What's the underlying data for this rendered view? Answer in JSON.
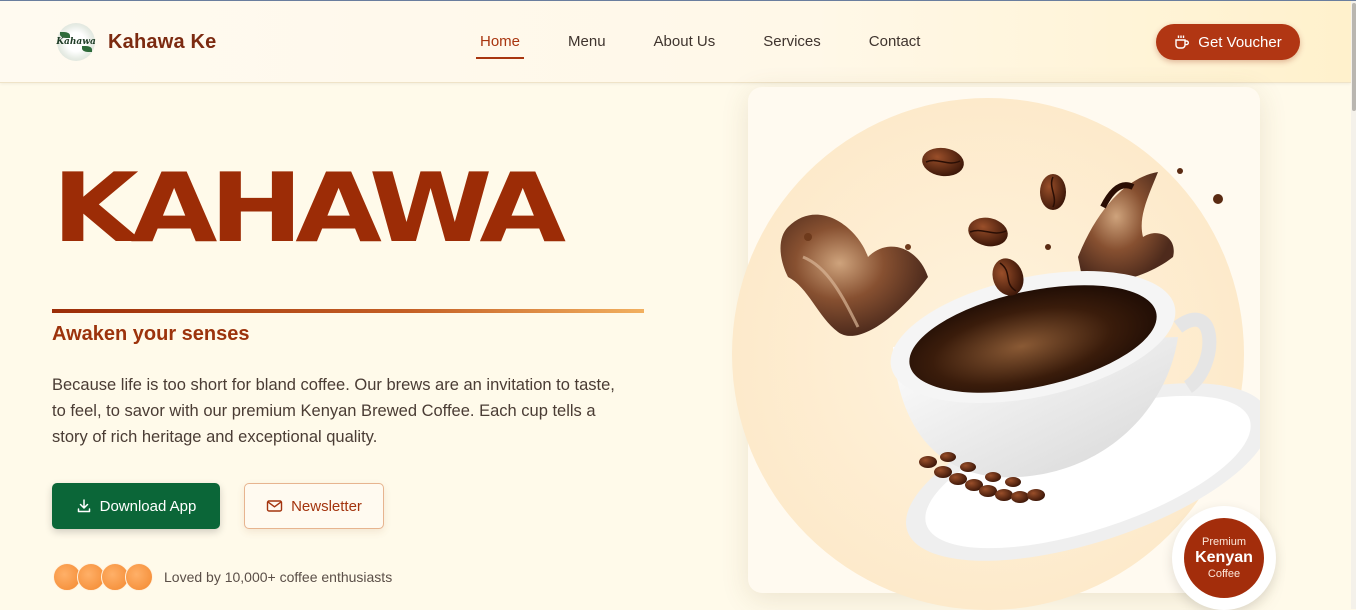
{
  "nav": {
    "brand": "Kahawa Ke",
    "logo_text": "Kahawa",
    "links": [
      "Home",
      "Menu",
      "About Us",
      "Services",
      "Contact"
    ],
    "active": "Home",
    "cta_label": "Get Voucher",
    "cta_icon": "coffee-cup-icon"
  },
  "hero": {
    "title": "KAHAWA",
    "tagline": "Awaken your senses",
    "description": "Because life is too short for bland coffee. Our brews are an invitation to taste, to feel, to savor with our premium Kenyan Brewed Coffee. Each cup tells a story of rich heritage and exceptional quality.",
    "download_label": "Download App",
    "download_icon": "download-icon",
    "newsletter_label": "Newsletter",
    "newsletter_icon": "mail-icon",
    "social_proof": "Loved by 10,000+ coffee enthusiasts"
  },
  "badge": {
    "line1": "Premium",
    "line2": "Kenyan",
    "line3": "Coffee"
  },
  "colors": {
    "brand": "#9c2c06",
    "cta": "#b13613",
    "download": "#0b6638",
    "background": "#fffaea"
  }
}
